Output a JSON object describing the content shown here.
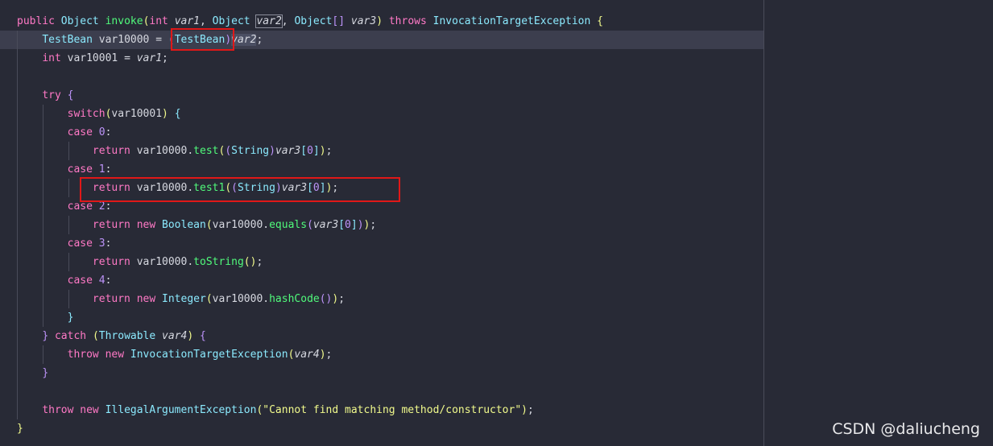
{
  "editor": {
    "lines": [
      {
        "indent": "",
        "tokens": [
          {
            "t": "public ",
            "c": "kw"
          },
          {
            "t": "Object ",
            "c": "ty"
          },
          {
            "t": "invoke",
            "c": "fn"
          },
          {
            "t": "(",
            "c": "p1"
          },
          {
            "t": "int ",
            "c": "kw"
          },
          {
            "t": "var1",
            "c": "pr"
          },
          {
            "t": ", "
          },
          {
            "t": "Object ",
            "c": "ty"
          },
          {
            "t": "var2",
            "c": "pr boxed"
          },
          {
            "t": ", "
          },
          {
            "t": "Object",
            "c": "ty"
          },
          {
            "t": "[] ",
            "c": "p2"
          },
          {
            "t": "var3",
            "c": "pr"
          },
          {
            "t": ") ",
            "c": "p1"
          },
          {
            "t": "throws ",
            "c": "kw"
          },
          {
            "t": "InvocationTargetException ",
            "c": "ty"
          },
          {
            "t": "{",
            "c": "p1"
          }
        ]
      },
      {
        "indent": "    ",
        "tokens": [
          {
            "t": "TestBean ",
            "c": "ty"
          },
          {
            "t": "var10000 = "
          },
          {
            "t": "(",
            "c": "p2"
          },
          {
            "t": "TestBean",
            "c": "ty"
          },
          {
            "t": ")",
            "c": "p2"
          },
          {
            "t": "var2",
            "c": "pr sel"
          },
          {
            "t": ";"
          }
        ]
      },
      {
        "indent": "    ",
        "tokens": [
          {
            "t": "int ",
            "c": "kw"
          },
          {
            "t": "var10001 = "
          },
          {
            "t": "var1",
            "c": "pr"
          },
          {
            "t": ";"
          }
        ]
      },
      {
        "indent": "",
        "tokens": []
      },
      {
        "indent": "    ",
        "tokens": [
          {
            "t": "try ",
            "c": "kw"
          },
          {
            "t": "{",
            "c": "p2"
          }
        ]
      },
      {
        "indent": "        ",
        "tokens": [
          {
            "t": "switch",
            "c": "kw"
          },
          {
            "t": "(",
            "c": "p1"
          },
          {
            "t": "var10001"
          },
          {
            "t": ") ",
            "c": "p1"
          },
          {
            "t": "{",
            "c": "p3"
          }
        ]
      },
      {
        "indent": "        ",
        "tokens": [
          {
            "t": "case ",
            "c": "kw"
          },
          {
            "t": "0",
            "c": "num"
          },
          {
            "t": ":"
          }
        ]
      },
      {
        "indent": "            ",
        "tokens": [
          {
            "t": "return ",
            "c": "kw"
          },
          {
            "t": "var10000."
          },
          {
            "t": "test",
            "c": "fn"
          },
          {
            "t": "(",
            "c": "p1"
          },
          {
            "t": "(",
            "c": "p2"
          },
          {
            "t": "String",
            "c": "ty"
          },
          {
            "t": ")",
            "c": "p2"
          },
          {
            "t": "var3",
            "c": "pr"
          },
          {
            "t": "[",
            "c": "p3"
          },
          {
            "t": "0",
            "c": "num"
          },
          {
            "t": "]",
            "c": "p3"
          },
          {
            "t": ")",
            "c": "p1"
          },
          {
            "t": ";"
          }
        ]
      },
      {
        "indent": "        ",
        "tokens": [
          {
            "t": "case ",
            "c": "kw"
          },
          {
            "t": "1",
            "c": "num"
          },
          {
            "t": ":"
          }
        ]
      },
      {
        "indent": "            ",
        "tokens": [
          {
            "t": "return ",
            "c": "kw"
          },
          {
            "t": "var10000."
          },
          {
            "t": "test1",
            "c": "fn"
          },
          {
            "t": "(",
            "c": "p1"
          },
          {
            "t": "(",
            "c": "p2"
          },
          {
            "t": "String",
            "c": "ty"
          },
          {
            "t": ")",
            "c": "p2"
          },
          {
            "t": "var3",
            "c": "pr"
          },
          {
            "t": "[",
            "c": "p3"
          },
          {
            "t": "0",
            "c": "num"
          },
          {
            "t": "]",
            "c": "p3"
          },
          {
            "t": ")",
            "c": "p1"
          },
          {
            "t": ";"
          }
        ]
      },
      {
        "indent": "        ",
        "tokens": [
          {
            "t": "case ",
            "c": "kw"
          },
          {
            "t": "2",
            "c": "num"
          },
          {
            "t": ":"
          }
        ]
      },
      {
        "indent": "            ",
        "tokens": [
          {
            "t": "return ",
            "c": "kw"
          },
          {
            "t": "new ",
            "c": "kw"
          },
          {
            "t": "Boolean",
            "c": "ty"
          },
          {
            "t": "(",
            "c": "p1"
          },
          {
            "t": "var10000."
          },
          {
            "t": "equals",
            "c": "fn"
          },
          {
            "t": "(",
            "c": "p2"
          },
          {
            "t": "var3",
            "c": "pr"
          },
          {
            "t": "[",
            "c": "p3"
          },
          {
            "t": "0",
            "c": "num"
          },
          {
            "t": "]",
            "c": "p3"
          },
          {
            "t": ")",
            "c": "p2"
          },
          {
            "t": ")",
            "c": "p1"
          },
          {
            "t": ";"
          }
        ]
      },
      {
        "indent": "        ",
        "tokens": [
          {
            "t": "case ",
            "c": "kw"
          },
          {
            "t": "3",
            "c": "num"
          },
          {
            "t": ":"
          }
        ]
      },
      {
        "indent": "            ",
        "tokens": [
          {
            "t": "return ",
            "c": "kw"
          },
          {
            "t": "var10000."
          },
          {
            "t": "toString",
            "c": "fn"
          },
          {
            "t": "()",
            "c": "p1"
          },
          {
            "t": ";"
          }
        ]
      },
      {
        "indent": "        ",
        "tokens": [
          {
            "t": "case ",
            "c": "kw"
          },
          {
            "t": "4",
            "c": "num"
          },
          {
            "t": ":"
          }
        ]
      },
      {
        "indent": "            ",
        "tokens": [
          {
            "t": "return ",
            "c": "kw"
          },
          {
            "t": "new ",
            "c": "kw"
          },
          {
            "t": "Integer",
            "c": "ty"
          },
          {
            "t": "(",
            "c": "p1"
          },
          {
            "t": "var10000."
          },
          {
            "t": "hashCode",
            "c": "fn"
          },
          {
            "t": "()",
            "c": "p2"
          },
          {
            "t": ")",
            "c": "p1"
          },
          {
            "t": ";"
          }
        ]
      },
      {
        "indent": "        ",
        "tokens": [
          {
            "t": "}",
            "c": "p3"
          }
        ]
      },
      {
        "indent": "    ",
        "tokens": [
          {
            "t": "} ",
            "c": "p2"
          },
          {
            "t": "catch ",
            "c": "kw"
          },
          {
            "t": "(",
            "c": "p1"
          },
          {
            "t": "Throwable ",
            "c": "ty"
          },
          {
            "t": "var4",
            "c": "pr"
          },
          {
            "t": ") ",
            "c": "p1"
          },
          {
            "t": "{",
            "c": "p2"
          }
        ]
      },
      {
        "indent": "        ",
        "tokens": [
          {
            "t": "throw ",
            "c": "kw"
          },
          {
            "t": "new ",
            "c": "kw"
          },
          {
            "t": "InvocationTargetException",
            "c": "ty"
          },
          {
            "t": "(",
            "c": "p1"
          },
          {
            "t": "var4",
            "c": "pr"
          },
          {
            "t": ")",
            "c": "p1"
          },
          {
            "t": ";"
          }
        ]
      },
      {
        "indent": "    ",
        "tokens": [
          {
            "t": "}",
            "c": "p2"
          }
        ]
      },
      {
        "indent": "",
        "tokens": []
      },
      {
        "indent": "    ",
        "tokens": [
          {
            "t": "throw ",
            "c": "kw"
          },
          {
            "t": "new ",
            "c": "kw"
          },
          {
            "t": "IllegalArgumentException",
            "c": "ty"
          },
          {
            "t": "(",
            "c": "p1"
          },
          {
            "t": "\"Cannot find matching method/constructor\"",
            "c": "str"
          },
          {
            "t": ")",
            "c": "p1"
          },
          {
            "t": ";"
          }
        ]
      },
      {
        "indent": "",
        "tokens": [
          {
            "t": "}",
            "c": "p1"
          }
        ]
      }
    ]
  },
  "watermark": "CSDN @daliucheng"
}
